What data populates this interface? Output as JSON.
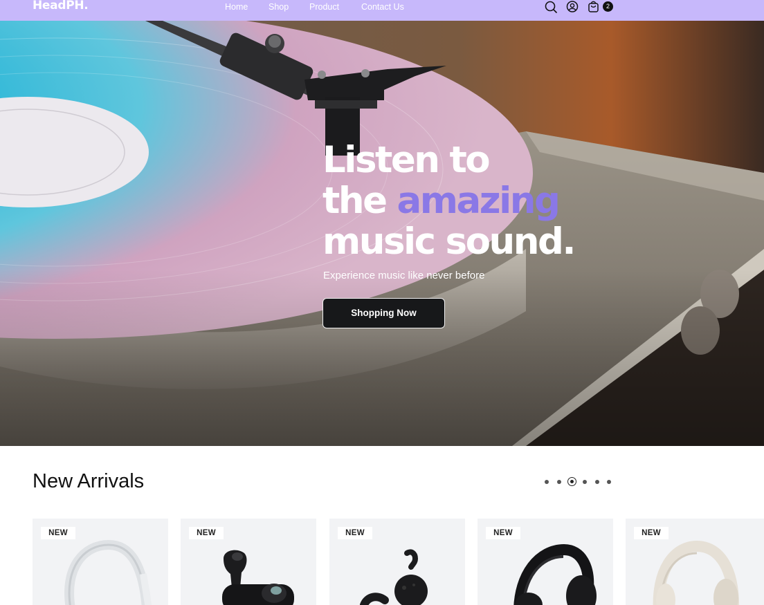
{
  "brand": {
    "logo": "HeadPH."
  },
  "nav": {
    "items": [
      "Home",
      "Shop",
      "Product",
      "Contact Us"
    ],
    "icons": [
      "search-icon",
      "user-icon",
      "cart-icon"
    ],
    "cart_count": "2"
  },
  "hero": {
    "title_line1": "Listen to",
    "title_line2_a": "the ",
    "title_line2_b": "amazing",
    "title_line3": "music sound.",
    "subtitle": "Experience music like never before",
    "button_label": "Shopping Now"
  },
  "arrivals": {
    "title": "New Arrivals",
    "active_slide": 3,
    "slide_count": 6,
    "products": [
      {
        "badge": "NEW",
        "image": "white-over-ear-headphones"
      },
      {
        "badge": "NEW",
        "image": "black-earbuds-with-case"
      },
      {
        "badge": "NEW",
        "image": "black-sport-earbuds"
      },
      {
        "badge": "NEW",
        "image": "black-over-ear-headphones"
      },
      {
        "badge": "NEW",
        "image": "cream-over-ear-headphones"
      }
    ]
  },
  "colors": {
    "nav_bg": "#c7b8fb",
    "accent": "#8a78e6",
    "button_bg": "#17181a"
  }
}
